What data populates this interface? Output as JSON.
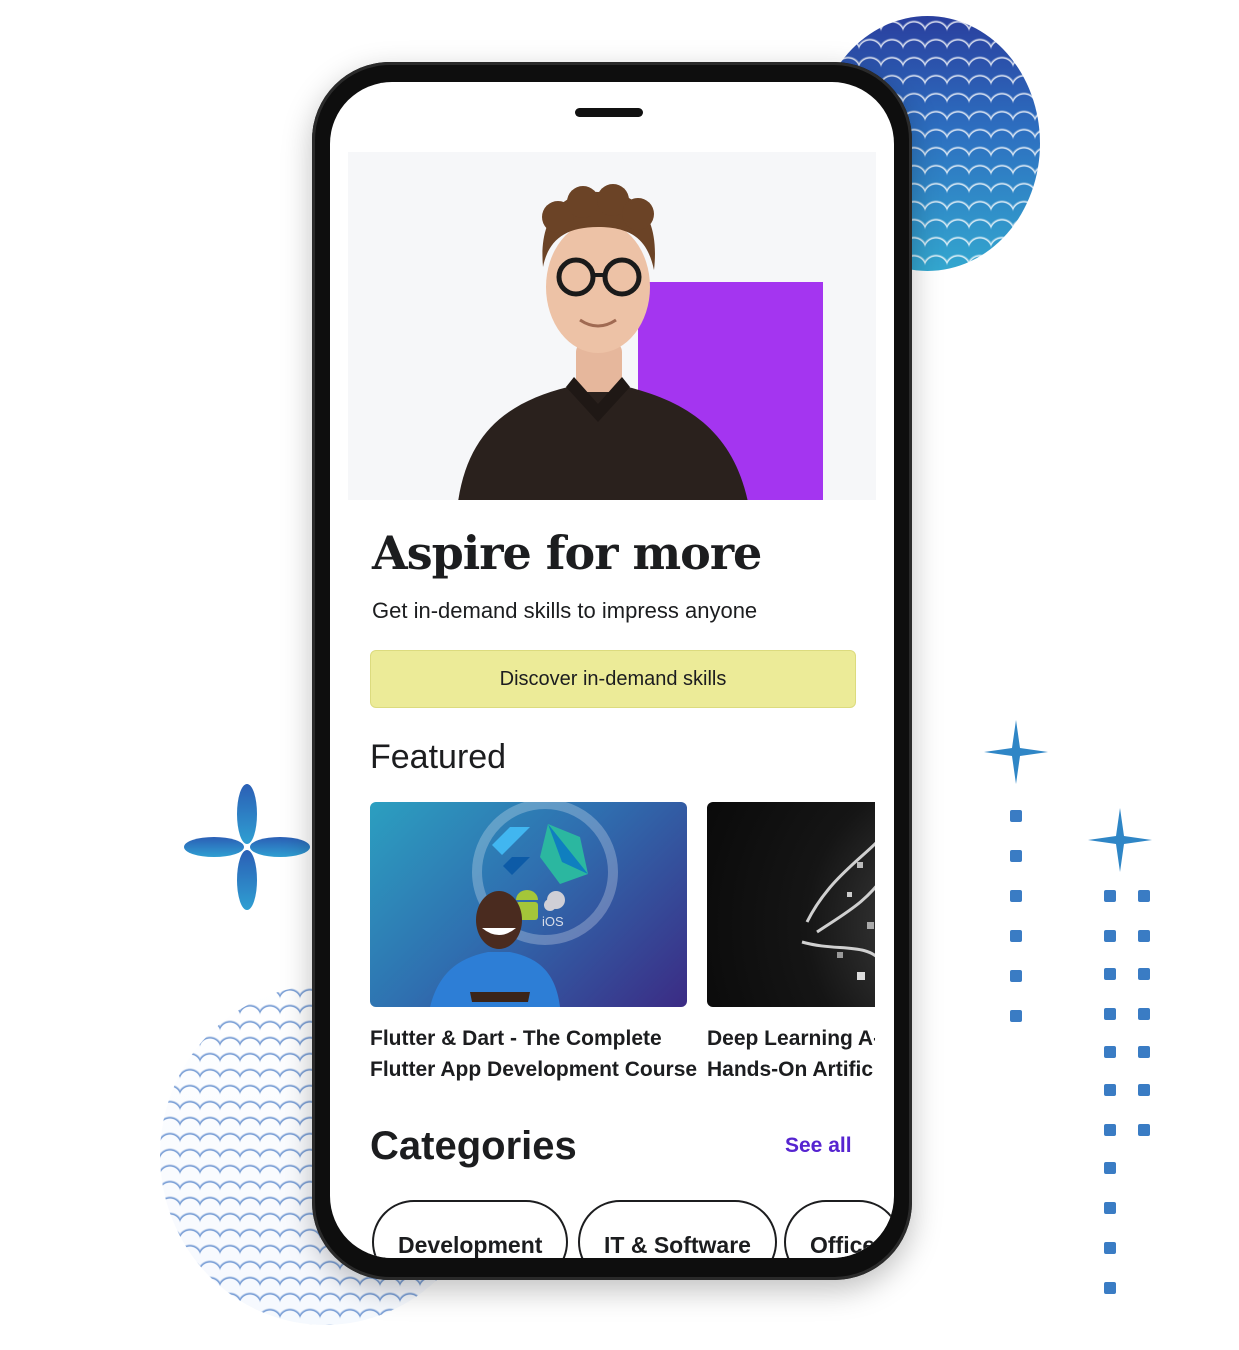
{
  "hero": {
    "headline": "Aspire for more",
    "subheadline": "Get in-demand skills to impress anyone",
    "cta_label": "Discover in-demand skills",
    "accent_color": "#a435f0",
    "cta_color": "#eceb98"
  },
  "featured": {
    "title": "Featured",
    "courses": [
      {
        "title_line1": "Flutter & Dart - The Complete",
        "title_line2": "Flutter App Development Course",
        "badge": "iOS"
      },
      {
        "title_line1": "Deep Learning A-",
        "title_line2": "Hands-On Artific"
      }
    ]
  },
  "categories": {
    "title": "Categories",
    "see_all_label": "See all",
    "link_color": "#5624d0",
    "items": [
      "Development",
      "IT & Software",
      "Office"
    ]
  },
  "icons": [
    "sparkle-icon",
    "android-icon",
    "apple-icon",
    "flutter-logo-icon",
    "dart-logo-icon"
  ]
}
